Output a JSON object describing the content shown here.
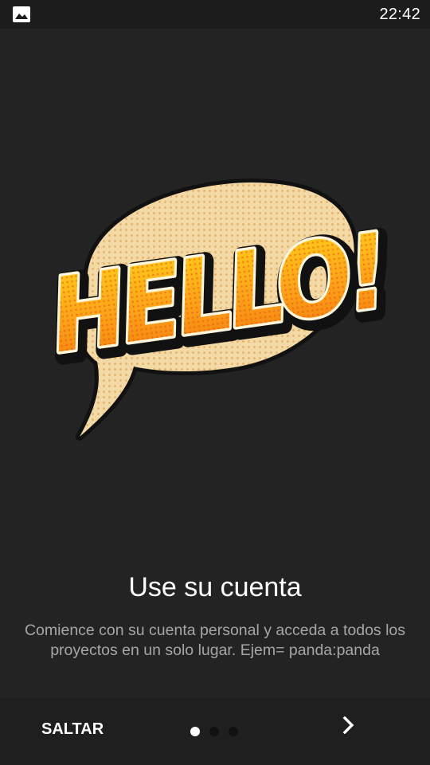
{
  "status_bar": {
    "time": "22:42",
    "notification_icon": "gallery-image-icon"
  },
  "illustration": {
    "text": "HELLO!",
    "icon": "hello-speech-bubble-illustration",
    "colors": {
      "bubble_fill": "#f3d9a6",
      "bubble_dots": "#e3ab62",
      "letter_top": "#ffd21a",
      "letter_bottom": "#f07a0c",
      "outline": "#111111"
    }
  },
  "onboarding": {
    "title": "Use su cuenta",
    "description": "Comience con su cuenta personal y acceda a todos los proyectos en un solo lugar. Ejem= panda:panda"
  },
  "navigation": {
    "skip_label": "SALTAR",
    "next_icon": "chevron-right-icon",
    "pages_total": 3,
    "current_page": 1
  },
  "colors": {
    "background": "#232323",
    "status_bar": "#1c1c1c",
    "bottom_bar": "#1f1f1f",
    "title_text": "#ffffff",
    "description_text": "#a6a6a6",
    "dot_active": "#ffffff",
    "dot_inactive": "#111111"
  }
}
